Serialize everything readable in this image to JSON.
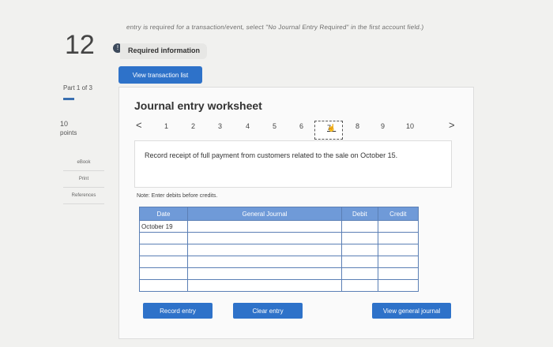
{
  "question": {
    "number": "12",
    "cut_off_text": "entry is required for a transaction/event, select \"No Journal Entry Required\" in the first account field.)",
    "info_icon": "info-icon",
    "required_info": "Required information"
  },
  "buttons": {
    "view_transactions": "View transaction list",
    "record_entry": "Record entry",
    "clear_entry": "Clear entry",
    "view_general_journal": "View general journal"
  },
  "side": {
    "part": "Part 1 of 3",
    "points_value": "10",
    "points_label": "points",
    "links": [
      "eBook",
      "Print",
      "References"
    ]
  },
  "worksheet": {
    "title": "Journal entry worksheet",
    "pages": [
      "1",
      "2",
      "3",
      "4",
      "5",
      "6",
      "7",
      "8",
      "9",
      "10"
    ],
    "current_page": "7",
    "prev_arrow": "<",
    "next_arrow": ">",
    "description": "Record receipt of full payment from customers related to the sale on October 15.",
    "note": "Note: Enter debits before credits."
  },
  "journal": {
    "headers": [
      "Date",
      "General Journal",
      "Debit",
      "Credit"
    ],
    "rows": [
      [
        "October 19",
        "",
        "",
        ""
      ],
      [
        "",
        "",
        "",
        ""
      ],
      [
        "",
        "",
        "",
        ""
      ],
      [
        "",
        "",
        "",
        ""
      ],
      [
        "",
        "",
        "",
        ""
      ],
      [
        "",
        "",
        "",
        ""
      ]
    ]
  },
  "colors": {
    "accent": "#2e72c9",
    "table_header": "#6f9ad8"
  }
}
